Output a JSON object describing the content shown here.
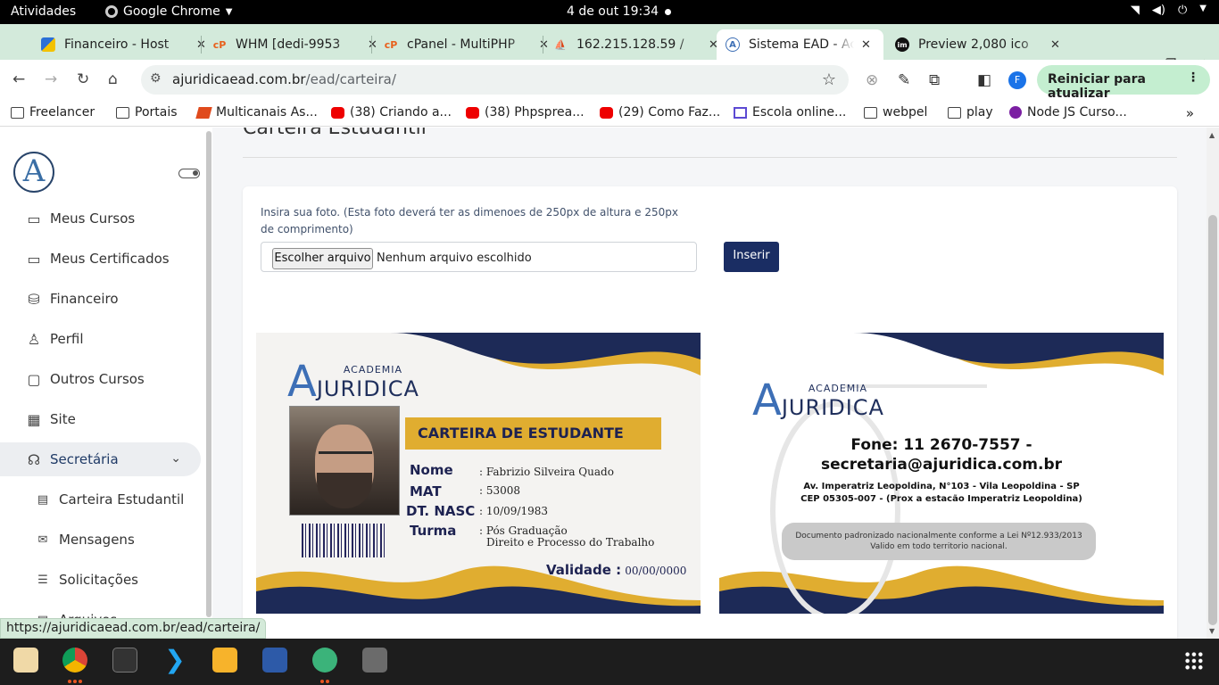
{
  "topbar": {
    "activities": "Atividades",
    "app_name": "Google Chrome",
    "clock": "4 de out  19:34"
  },
  "tabs": [
    {
      "title": "Financeiro - Host",
      "favicon": "flag-icon"
    },
    {
      "title": "WHM [dedi-9953",
      "favicon": "cpanel-icon"
    },
    {
      "title": "cPanel - MultiPHP",
      "favicon": "cpanel-icon"
    },
    {
      "title": "162.215.128.59 /",
      "favicon": "phpmyadmin-icon"
    },
    {
      "title": "Sistema EAD - Ac",
      "favicon": "site-icon",
      "active": true
    },
    {
      "title": "Preview 2,080 ico",
      "favicon": "im-icon"
    }
  ],
  "toolbar": {
    "url_host": "ajuridicaead.com.br",
    "url_path": "/ead/carteira/",
    "profile_initial": "F",
    "update_label": "Reiniciar para atualizar"
  },
  "bookmarks": [
    {
      "label": "Freelancer",
      "icon": "folder"
    },
    {
      "label": "Portais",
      "icon": "folder"
    },
    {
      "label": "Multicanais As...",
      "icon": "red"
    },
    {
      "label": "(38) Criando a...",
      "icon": "yt"
    },
    {
      "label": "(38) Phpsprea...",
      "icon": "yt"
    },
    {
      "label": "(29) Como Faz...",
      "icon": "yt"
    },
    {
      "label": "Escola online...",
      "icon": "school"
    },
    {
      "label": "webpel",
      "icon": "folder"
    },
    {
      "label": "play",
      "icon": "folder"
    },
    {
      "label": "Node JS Curso...",
      "icon": "purple"
    }
  ],
  "sidebar": {
    "logo_letter": "A",
    "items": [
      {
        "label": "Meus Cursos",
        "icon": "folder-icon"
      },
      {
        "label": "Meus Certificados",
        "icon": "folder-icon"
      },
      {
        "label": "Financeiro",
        "icon": "money-icon"
      },
      {
        "label": "Perfil",
        "icon": "user-icon"
      },
      {
        "label": "Outros Cursos",
        "icon": "monitor-icon"
      },
      {
        "label": "Site",
        "icon": "building-icon"
      },
      {
        "label": "Secretária",
        "icon": "headset-icon",
        "active": true
      },
      {
        "label": "Carteira Estudantil",
        "icon": "id-card-icon"
      },
      {
        "label": "Mensagens",
        "icon": "mail-icon"
      },
      {
        "label": "Solicitações",
        "icon": "list-icon"
      },
      {
        "label": "Arquivos",
        "icon": "file-icon"
      }
    ]
  },
  "content": {
    "heading": "Carteira Estudantil",
    "upload_label": "Insira sua foto. (Esta foto deverá ter as dimenoes de 250px de altura e 250px de comprimento)",
    "file_button": "Escolher arquivo",
    "file_status": "Nenhum arquivo escolhido",
    "insert_button": "Inserir"
  },
  "card_front": {
    "brand_top": "ACADEMIA",
    "brand_main": "JURIDICA",
    "title": "CARTEIRA DE ESTUDANTE",
    "fields": [
      {
        "label": "Nome",
        "value": ": Fabrizio Silveira Quado"
      },
      {
        "label": "MAT",
        "value": ": 53008"
      },
      {
        "label": "DT. NASC",
        "value": ": 10/09/1983"
      },
      {
        "label": "Turma",
        "value": ": Pós Graduação"
      }
    ],
    "turma_line2": "Direito e Processo do Trabalho",
    "validity_label": "Validade :",
    "validity_value": "00/00/0000"
  },
  "card_back": {
    "brand_top": "ACADEMIA",
    "brand_main": "JURIDICA",
    "phone": "Fone: 11 2670-7557 -",
    "email": "secretaria@ajuridica.com.br",
    "address1": "Av. Imperatriz Leopoldina, N°103 - Vila Leopoldina - SP",
    "address2": "CEP 05305-007 - (Prox a estacão Imperatriz Leopoldina)",
    "disclaimer1": "Documento padronizado nacionalmente conforme a Lei Nº12.933/2013",
    "disclaimer2": "Valido em todo territorio nacional."
  },
  "status_url": "https://ajuridicaead.com.br/ead/carteira/",
  "colors": {
    "navy": "#1d2251",
    "gold": "#e0ad30",
    "insert_button": "#1a2d63",
    "tabstrip": "#d3eadb"
  }
}
